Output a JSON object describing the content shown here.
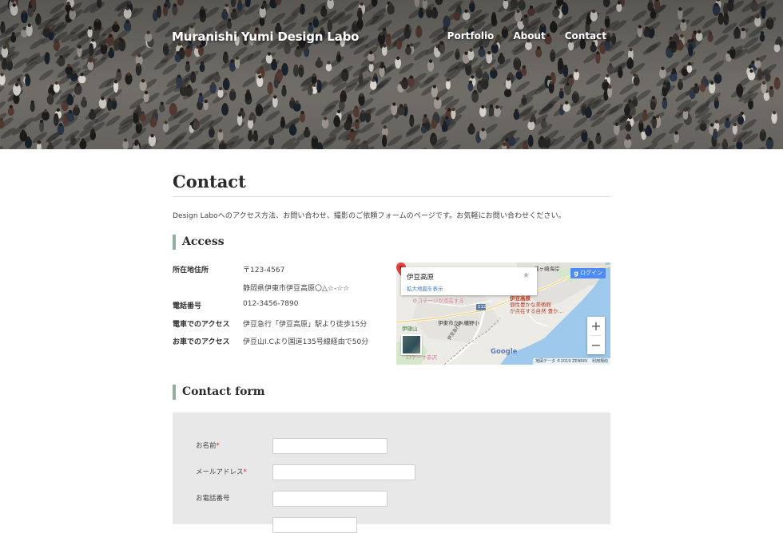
{
  "header": {
    "site_title": "Muranishi Yumi Design Labo",
    "nav": [
      "Portfolio",
      "About",
      "Contact"
    ]
  },
  "page": {
    "title": "Contact",
    "intro": "Design Laboへのアクセス方法、お問い合わせ、撮影のご依頼フォームのページです。お気軽にお問い合わせください。"
  },
  "access": {
    "heading": "Access",
    "rows": [
      {
        "label": "所在地住所",
        "value": "〒123-4567"
      },
      {
        "label": "",
        "value": "静岡県伊東市伊豆高原〇△☆-☆☆"
      },
      {
        "label": "電話番号",
        "value": "012-3456-7890"
      },
      {
        "label": "電車でのアクセス",
        "value": "伊豆急行「伊豆高原」駅より徒歩15分"
      },
      {
        "label": "お車でのアクセス",
        "value": "伊豆山I.Cより国道135号線経由で50分"
      }
    ]
  },
  "map": {
    "place_name": "伊豆高原",
    "larger_map_link": "拡大地図を表示",
    "login_label": "ログイン",
    "login_g": "g",
    "zoom_in": "+",
    "zoom_out": "−",
    "google_logo": "Google",
    "footer_data": "地図データ ©2019 ZENRIN",
    "footer_terms": "利用規約",
    "labels": {
      "jogasaki": "城ヶ崎海岸",
      "izukogen_pin": "伊豆高原",
      "pin_desc_1": "個性豊かな美術館",
      "pin_desc_2": "が点在する自然 豊か...",
      "yuzuriyama": "伊雄山",
      "school": "伊東市立八幡野小",
      "road": "112",
      "line": "伊豆急行線",
      "akazawa": "ロケーサ赤沢",
      "cottage": "ゆコテージが点在する"
    }
  },
  "contact_form": {
    "heading": "Contact form",
    "required_mark": "*",
    "fields": [
      {
        "label": "お名前",
        "required": true,
        "value": ""
      },
      {
        "label": "メールアドレス",
        "required": true,
        "value": ""
      },
      {
        "label": "お電話番号",
        "required": false,
        "value": ""
      }
    ]
  },
  "colors": {
    "accent_bar": "#8fae9b",
    "form_background": "#e8e8e8",
    "required": "#d0322f"
  }
}
